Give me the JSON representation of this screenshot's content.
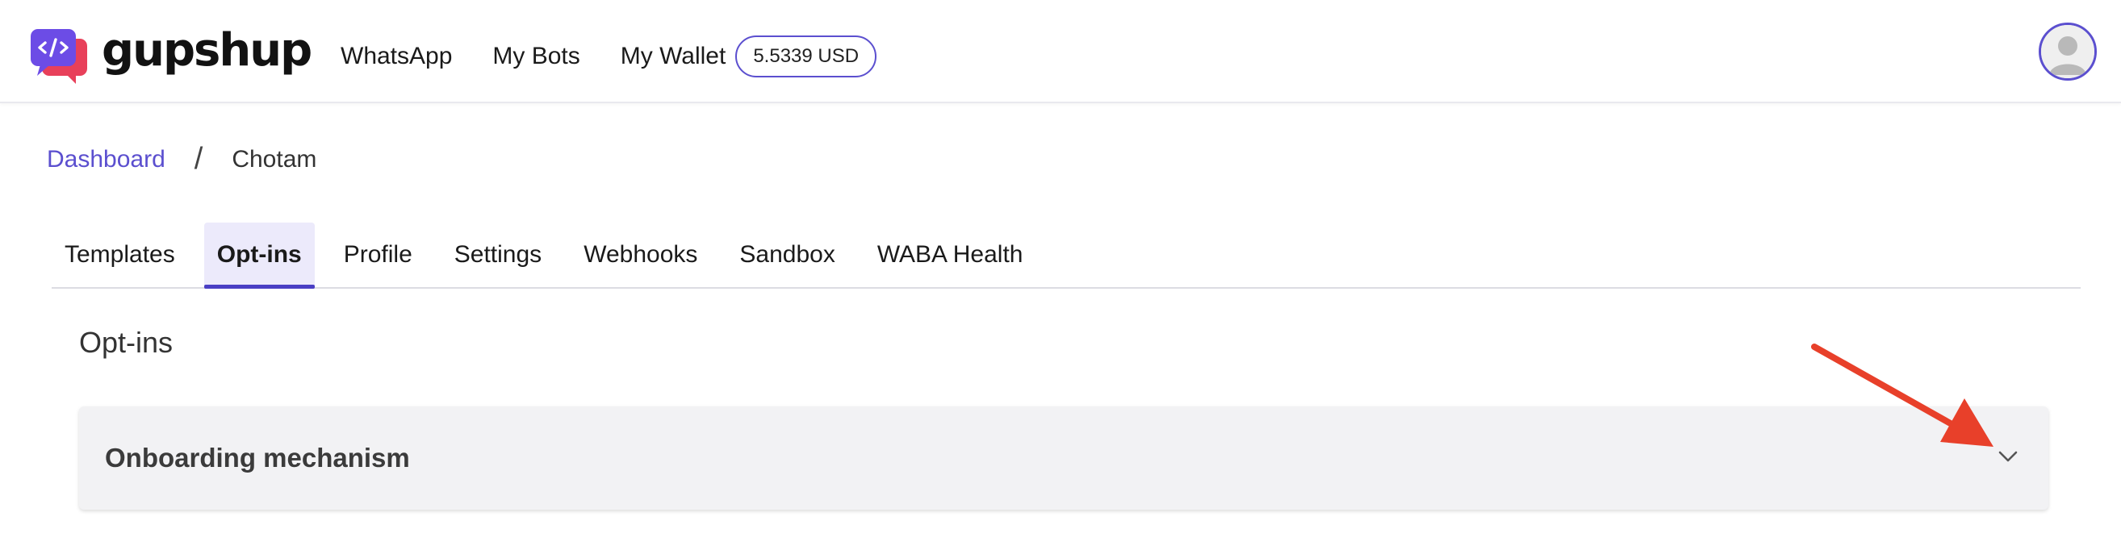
{
  "brand": {
    "name": "gupshup",
    "icon": "chat-code-logo-icon"
  },
  "nav": {
    "items": [
      {
        "label": "WhatsApp"
      },
      {
        "label": "My Bots"
      }
    ],
    "wallet_label": "My Wallet",
    "wallet_balance": "5.5339 USD"
  },
  "user": {
    "avatar_icon": "user-avatar-icon"
  },
  "breadcrumb": {
    "root": "Dashboard",
    "separator": "/",
    "current": "Chotam"
  },
  "tabs": [
    {
      "label": "Templates",
      "active": false
    },
    {
      "label": "Opt-ins",
      "active": true
    },
    {
      "label": "Profile",
      "active": false
    },
    {
      "label": "Settings",
      "active": false
    },
    {
      "label": "Webhooks",
      "active": false
    },
    {
      "label": "Sandbox",
      "active": false
    },
    {
      "label": "WABA Health",
      "active": false
    }
  ],
  "main": {
    "title": "Opt-ins",
    "accordion": {
      "title": "Onboarding mechanism",
      "expanded": false,
      "icon": "chevron-down-icon"
    }
  },
  "annotation": {
    "icon": "red-arrow-icon",
    "color": "#e8402a"
  },
  "colors": {
    "accent": "#5b4fcf",
    "tab_active_bg": "#eceafb",
    "accordion_bg": "#f2f2f4"
  }
}
